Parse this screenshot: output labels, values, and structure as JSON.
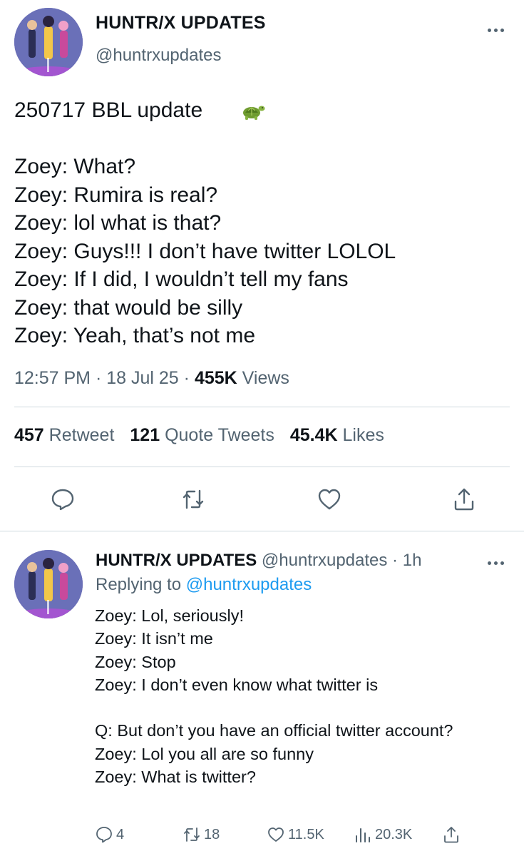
{
  "main_tweet": {
    "display_name": "HUNTR/X UPDATES",
    "handle": "@huntrxupdates",
    "body": "250717 BBL update\n\nZoey: What?\nZoey: Rumira is real?\nZoey: lol what is that?\nZoey: Guys!!! I don’t have twitter LOLOL\nZoey: If I did, I wouldn’t tell my fans\nZoey: that would be silly\nZoey: Yeah, that’s not me",
    "emoji": "turtle",
    "time": "12:57 PM",
    "date": "18 Jul 25",
    "views_count": "455K",
    "views_label": "Views",
    "retweets_count": "457",
    "retweets_label": "Retweet",
    "quotes_count": "121",
    "quotes_label": "Quote Tweets",
    "likes_count": "45.4K",
    "likes_label": "Likes",
    "actions": [
      "reply-icon",
      "retweet-icon",
      "like-icon",
      "share-icon"
    ]
  },
  "reply_tweet": {
    "display_name": "HUNTR/X UPDATES",
    "handle": "@huntrxupdates",
    "age": "1h",
    "replying_to_label": "Replying to",
    "replying_to_handle": "@huntrxupdates",
    "body": "Zoey: Lol, seriously!\nZoey: It isn’t me\nZoey: Stop\nZoey: I don’t even know what twitter is\n\nQ: But don’t you have an official twitter account?\nZoey: Lol you all are so funny\nZoey: What is twitter?",
    "reply_count": "4",
    "retweet_count": "18",
    "like_count": "11.5K",
    "view_count": "20.3K"
  },
  "colors": {
    "text": "#0f1419",
    "muted": "#536471",
    "link": "#1d9bf0",
    "divider": "#cfd9de"
  }
}
